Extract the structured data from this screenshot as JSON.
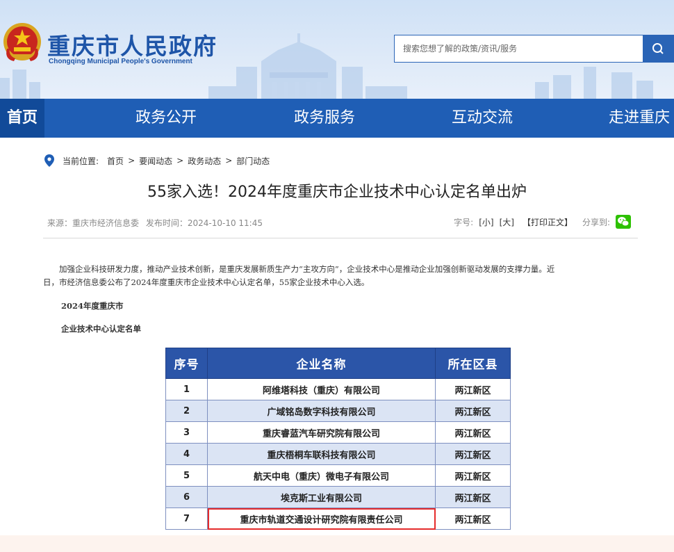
{
  "header": {
    "logo_cn": "重庆市人民政府",
    "logo_en": "Chongqing Municipal People's Government",
    "search_placeholder": "搜索您想了解的政策/资讯/服务"
  },
  "nav": [
    "首页",
    "政务公开",
    "政务服务",
    "互动交流",
    "走进重庆"
  ],
  "breadcrumb": {
    "label": "当前位置:",
    "items": [
      "首页",
      "要闻动态",
      "政务动态",
      "部门动态"
    ],
    "separator": ">"
  },
  "article": {
    "title": "55家入选！2024年度重庆市企业技术中心认定名单出炉",
    "source": "来源：重庆市经济信息委",
    "published": "发布时间：2024-10-10 11:45",
    "tools": {
      "font_label": "字号:",
      "small": "[小]",
      "large": "[大]",
      "print": "【打印正文】",
      "share": "分享到:"
    },
    "paragraph_line1": "加强企业科技研发力度，推动产业技术创新，是重庆发展新质生产力“主攻方向”，企业技术中心是推动企业加强创新驱动发展的支撑力量。近",
    "paragraph_line2": "日，市经济信息委公布了2024年度重庆市企业技术中心认定名单，55家企业技术中心入选。",
    "subtitle1": "2024年度重庆市",
    "subtitle2": "企业技术中心认定名单"
  },
  "table": {
    "headers": [
      "序号",
      "企业名称",
      "所在区县"
    ],
    "rows": [
      [
        "1",
        "阿维塔科技（重庆）有限公司",
        "两江新区"
      ],
      [
        "2",
        "广域铭岛数字科技有限公司",
        "两江新区"
      ],
      [
        "3",
        "重庆睿蓝汽车研究院有限公司",
        "两江新区"
      ],
      [
        "4",
        "重庆梧桐车联科技有限公司",
        "两江新区"
      ],
      [
        "5",
        "航天中电（重庆）微电子有限公司",
        "两江新区"
      ],
      [
        "6",
        "埃克斯工业有限公司",
        "两江新区"
      ],
      [
        "7",
        "重庆市轨道交通设计研究院有限责任公司",
        "两江新区"
      ]
    ]
  },
  "colors": {
    "nav_blue": "#1f5eb5",
    "nav_home": "#114a99",
    "table_header": "#2b55a8",
    "table_alt_row": "#dbe4f4",
    "highlight_red": "#e52b2b",
    "wechat_green": "#2dc100"
  }
}
